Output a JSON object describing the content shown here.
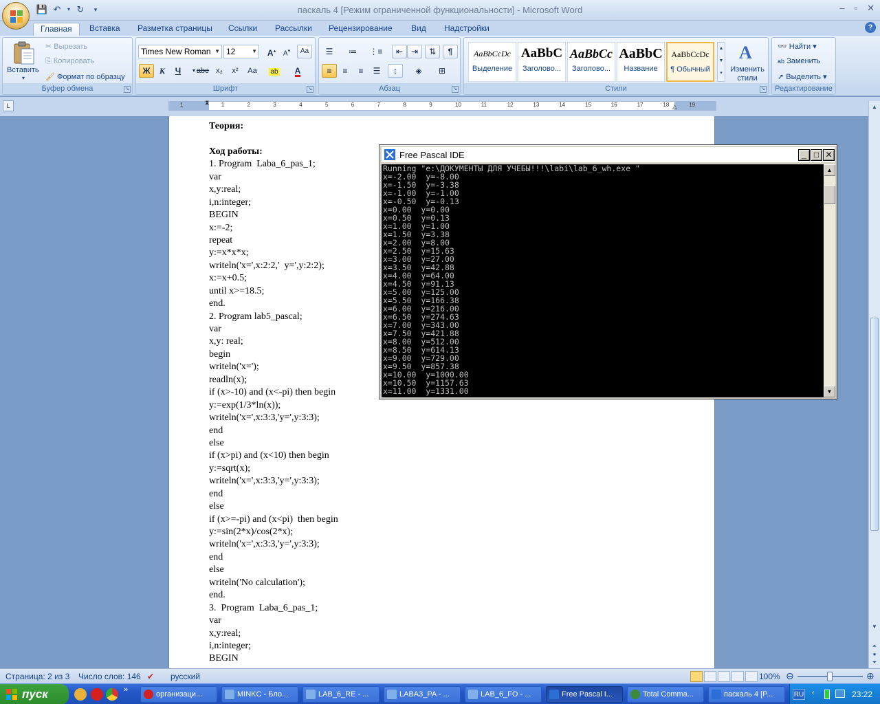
{
  "word": {
    "title": "паскаль 4 [Режим ограниченной функциональности] - Microsoft Word",
    "tabs": [
      "Главная",
      "Вставка",
      "Разметка страницы",
      "Ссылки",
      "Рассылки",
      "Рецензирование",
      "Вид",
      "Надстройки"
    ],
    "clipboard": {
      "paste": "Вставить",
      "cut": "Вырезать",
      "copy": "Копировать",
      "format_painter": "Формат по образцу",
      "label": "Буфер обмена"
    },
    "font": {
      "name": "Times New Roman",
      "size": "12",
      "label": "Шрифт",
      "bold": "Ж",
      "italic": "К",
      "underline": "Ч",
      "strike": "abe",
      "subscript": "x₂",
      "superscript": "x²",
      "case": "Aa"
    },
    "paragraph": {
      "label": "Абзац"
    },
    "styles": {
      "label": "Стили",
      "items": [
        {
          "sample": "AaBbCcDc",
          "name": "Выделение"
        },
        {
          "sample": "AaBbC",
          "name": "Заголово..."
        },
        {
          "sample": "AaBbCc",
          "name": "Заголово..."
        },
        {
          "sample": "AaBbC",
          "name": "Название"
        },
        {
          "sample": "AaBbCcDc",
          "name": "¶ Обычный"
        }
      ],
      "change": "Изменить стили"
    },
    "editing": {
      "label": "Редактирование",
      "find": "Найти",
      "replace": "Заменить",
      "select": "Выделить"
    },
    "ruler_numbers": [
      "1",
      "1",
      "2",
      "3",
      "4",
      "5",
      "6",
      "7",
      "8",
      "9",
      "10",
      "11",
      "12",
      "13",
      "14",
      "15",
      "16",
      "17",
      "18",
      "19"
    ],
    "document_lines": [
      {
        "text": "Теория:",
        "bold": true
      },
      {
        "text": "",
        "bold": false
      },
      {
        "text": "Ход работы:",
        "bold": true
      },
      {
        "text": "1. Program  Laba_6_pas_1;",
        "bold": false
      },
      {
        "text": "var",
        "bold": false
      },
      {
        "text": "x,y:real;",
        "bold": false
      },
      {
        "text": "i,n:integer;",
        "bold": false
      },
      {
        "text": "BEGIN",
        "bold": false
      },
      {
        "text": "x:=-2;",
        "bold": false
      },
      {
        "text": "repeat",
        "bold": false
      },
      {
        "text": "y:=x*x*x;",
        "bold": false
      },
      {
        "text": "writeln('x=',x:2:2,'  y=',y:2:2);",
        "bold": false
      },
      {
        "text": "x:=x+0.5;",
        "bold": false
      },
      {
        "text": "until x>=18.5;",
        "bold": false
      },
      {
        "text": "end.",
        "bold": false
      },
      {
        "text": "2. Program lab5_pascal;",
        "bold": false
      },
      {
        "text": "var",
        "bold": false
      },
      {
        "text": "x,y: real;",
        "bold": false
      },
      {
        "text": "begin",
        "bold": false
      },
      {
        "text": "writeln('x=');",
        "bold": false
      },
      {
        "text": "readln(x);",
        "bold": false
      },
      {
        "text": "if (x>-10) and (x<-pi) then begin",
        "bold": false
      },
      {
        "text": "y:=exp(1/3*ln(x));",
        "bold": false
      },
      {
        "text": "writeln('x=',x:3:3,'y=',y:3:3);",
        "bold": false
      },
      {
        "text": "end",
        "bold": false
      },
      {
        "text": "else",
        "bold": false
      },
      {
        "text": "if (x>pi) and (x<10) then begin",
        "bold": false
      },
      {
        "text": "y:=sqrt(x);",
        "bold": false
      },
      {
        "text": "writeln('x=',x:3:3,'y=',y:3:3);",
        "bold": false
      },
      {
        "text": "end",
        "bold": false
      },
      {
        "text": "else",
        "bold": false
      },
      {
        "text": "if (x>=-pi) and (x<pi)  then begin",
        "bold": false
      },
      {
        "text": "y:=sin(2*x)/cos(2*x);",
        "bold": false
      },
      {
        "text": "writeln('x=',x:3:3,'y=',y:3:3);",
        "bold": false
      },
      {
        "text": "end",
        "bold": false
      },
      {
        "text": "else",
        "bold": false
      },
      {
        "text": "writeln('No calculation');",
        "bold": false
      },
      {
        "text": "end.",
        "bold": false
      },
      {
        "text": "3.  Program  Laba_6_pas_1;",
        "bold": false
      },
      {
        "text": "var",
        "bold": false
      },
      {
        "text": "x,y:real;",
        "bold": false
      },
      {
        "text": "i,n:integer;",
        "bold": false
      },
      {
        "text": "BEGIN",
        "bold": false
      }
    ],
    "status": {
      "page": "Страница: 2 из 3",
      "words": "Число слов: 146",
      "language": "русский",
      "zoom": "100%"
    }
  },
  "fpc": {
    "title": "Free Pascal IDE",
    "console_lines": [
      "Running \"e:\\ДОКУМЕНТЫ ДЛЯ УЧЕБЫ!!!\\labi\\lab_6_wh.exe \"",
      "x=-2.00  y=-8.00",
      "x=-1.50  y=-3.38",
      "x=-1.00  y=-1.00",
      "x=-0.50  y=-0.13",
      "x=0.00  y=0.00",
      "x=0.50  y=0.13",
      "x=1.00  y=1.00",
      "x=1.50  y=3.38",
      "x=2.00  y=8.00",
      "x=2.50  y=15.63",
      "x=3.00  y=27.00",
      "x=3.50  y=42.88",
      "x=4.00  y=64.00",
      "x=4.50  y=91.13",
      "x=5.00  y=125.00",
      "x=5.50  y=166.38",
      "x=6.00  y=216.00",
      "x=6.50  y=274.63",
      "x=7.00  y=343.00",
      "x=7.50  y=421.88",
      "x=8.00  y=512.00",
      "x=8.50  y=614.13",
      "x=9.00  y=729.00",
      "x=9.50  y=857.38",
      "x=10.00  y=1000.00",
      "x=10.50  y=1157.63",
      "x=11.00  y=1331.00"
    ]
  },
  "taskbar": {
    "start": "пуск",
    "items": [
      {
        "label": "организаци...",
        "color": "#d32020"
      },
      {
        "label": "MINKC - Бло...",
        "color": "#2b6fd6"
      },
      {
        "label": "LAB_6_RE - ...",
        "color": "#2b6fd6"
      },
      {
        "label": "LABA3_PA - ...",
        "color": "#2b6fd6"
      },
      {
        "label": "LAB_6_FO - ...",
        "color": "#2b6fd6"
      },
      {
        "label": "Free Pascal I...",
        "color": "#2b6fd6"
      },
      {
        "label": "Total Comma...",
        "color": "#3b8a3b"
      },
      {
        "label": "паскаль 4 [P...",
        "color": "#2b6fd6"
      }
    ],
    "lang": "RU",
    "clock": "23:22"
  }
}
